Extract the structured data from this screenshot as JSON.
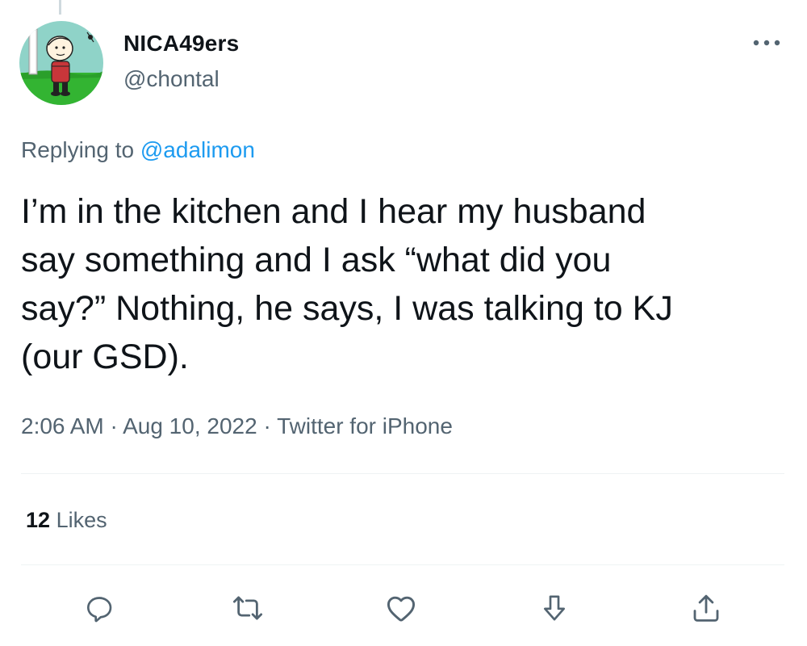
{
  "user": {
    "display_name": "NICA49ers",
    "handle": "@chontal",
    "avatar_icon": "avatar-image"
  },
  "reply": {
    "prefix": "Replying to ",
    "mention": "@adalimon"
  },
  "tweet": {
    "text": "I’m in the kitchen and I hear my husband\nsay something and I ask “what did you\nsay?”  Nothing, he says, I was talking to KJ\n(our GSD)."
  },
  "meta": {
    "time": "2:06 AM",
    "separator": " · ",
    "date": "Aug 10, 2022",
    "source": "Twitter for iPhone"
  },
  "stats": {
    "likes_count": "12",
    "likes_label": "Likes"
  },
  "actions": {
    "reply": "reply-icon",
    "retweet": "retweet-icon",
    "like": "heart-icon",
    "bookmark": "bookmark-icon",
    "share": "share-icon"
  },
  "colors": {
    "text": "#0f1419",
    "secondary": "#536471",
    "link": "#1d9bf0",
    "divider": "#eff3f4"
  }
}
